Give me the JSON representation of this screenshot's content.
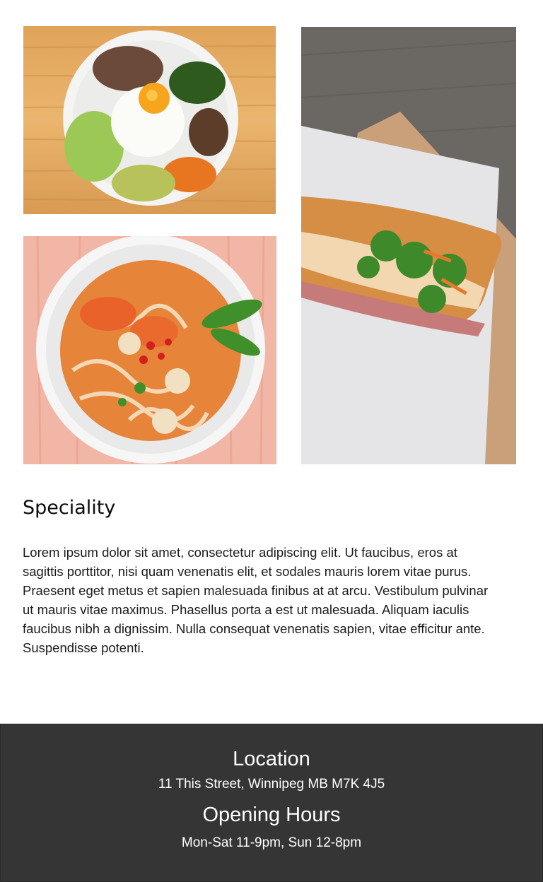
{
  "gallery": {
    "images": [
      {
        "name": "bibimbap-photo"
      },
      {
        "name": "noodle-soup-photo"
      },
      {
        "name": "banh-mi-photo"
      }
    ]
  },
  "speciality": {
    "title": "Speciality",
    "body": "Lorem ipsum dolor sit amet, consectetur adipiscing elit. Ut faucibus, eros at sagittis porttitor, nisi quam venenatis elit, et sodales mauris lorem vitae purus. Praesent eget metus et sapien malesuada finibus at at arcu. Vestibulum pulvinar ut mauris vitae maximus. Phasellus porta a est ut malesuada. Aliquam iaculis faucibus nibh a dignissim. Nulla consequat venenatis sapien, vitae efficitur ante. Suspendisse potenti."
  },
  "footer": {
    "location_heading": "Location",
    "location_detail": "11 This Street, Winnipeg MB M7K 4J5",
    "hours_heading": "Opening Hours",
    "hours_detail": "Mon-Sat 11-9pm, Sun 12-8pm"
  },
  "colors": {
    "footer_bg": "#353535",
    "footer_text": "#ffffff"
  }
}
